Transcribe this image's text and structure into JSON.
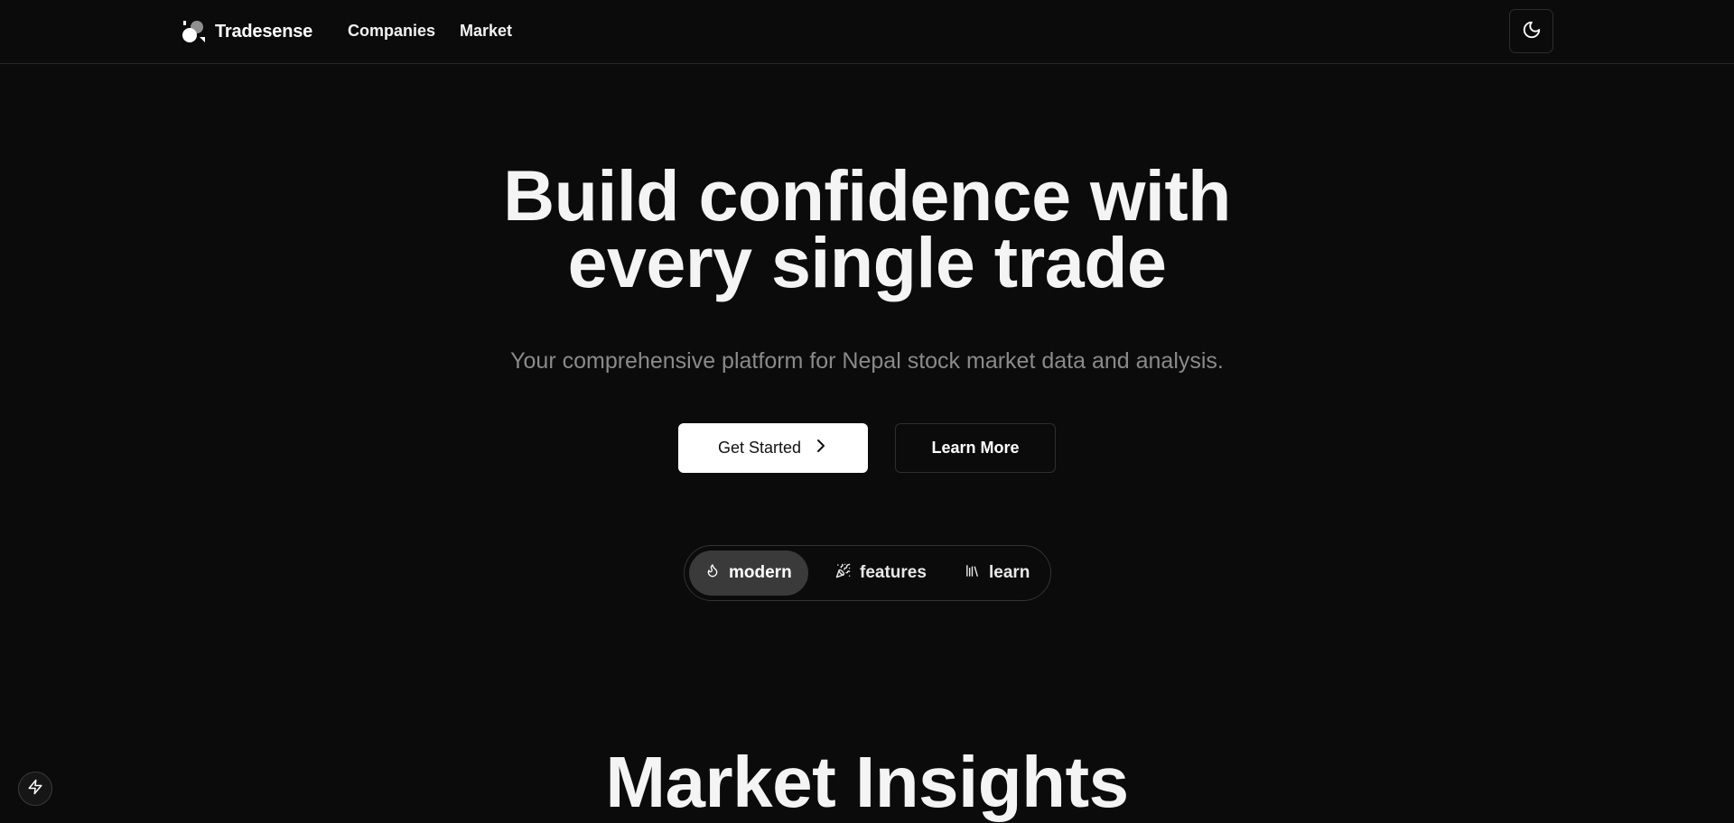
{
  "header": {
    "brand": "Tradesense",
    "nav": [
      {
        "label": "Companies"
      },
      {
        "label": "Market"
      }
    ],
    "theme_toggle_icon": "moon-icon"
  },
  "hero": {
    "title_line1": "Build confidence with",
    "title_line2": "every single trade",
    "subtitle": "Your comprehensive platform for Nepal stock market data and analysis.",
    "primary_button": "Get Started",
    "primary_button_icon": "chevron-right-icon",
    "secondary_button": "Learn More"
  },
  "tabs": [
    {
      "label": "modern",
      "icon": "flame-icon",
      "active": true
    },
    {
      "label": "features",
      "icon": "party-popper-icon",
      "active": false
    },
    {
      "label": "learn",
      "icon": "library-icon",
      "active": false
    }
  ],
  "section": {
    "title": "Market Insights"
  },
  "floating_button_icon": "lightning-icon",
  "colors": {
    "background": "#0b0b0b",
    "text": "#f4f4f4",
    "muted": "#8a8a8a",
    "active_tab": "#3a3a3a",
    "primary_button_bg": "#ffffff"
  }
}
